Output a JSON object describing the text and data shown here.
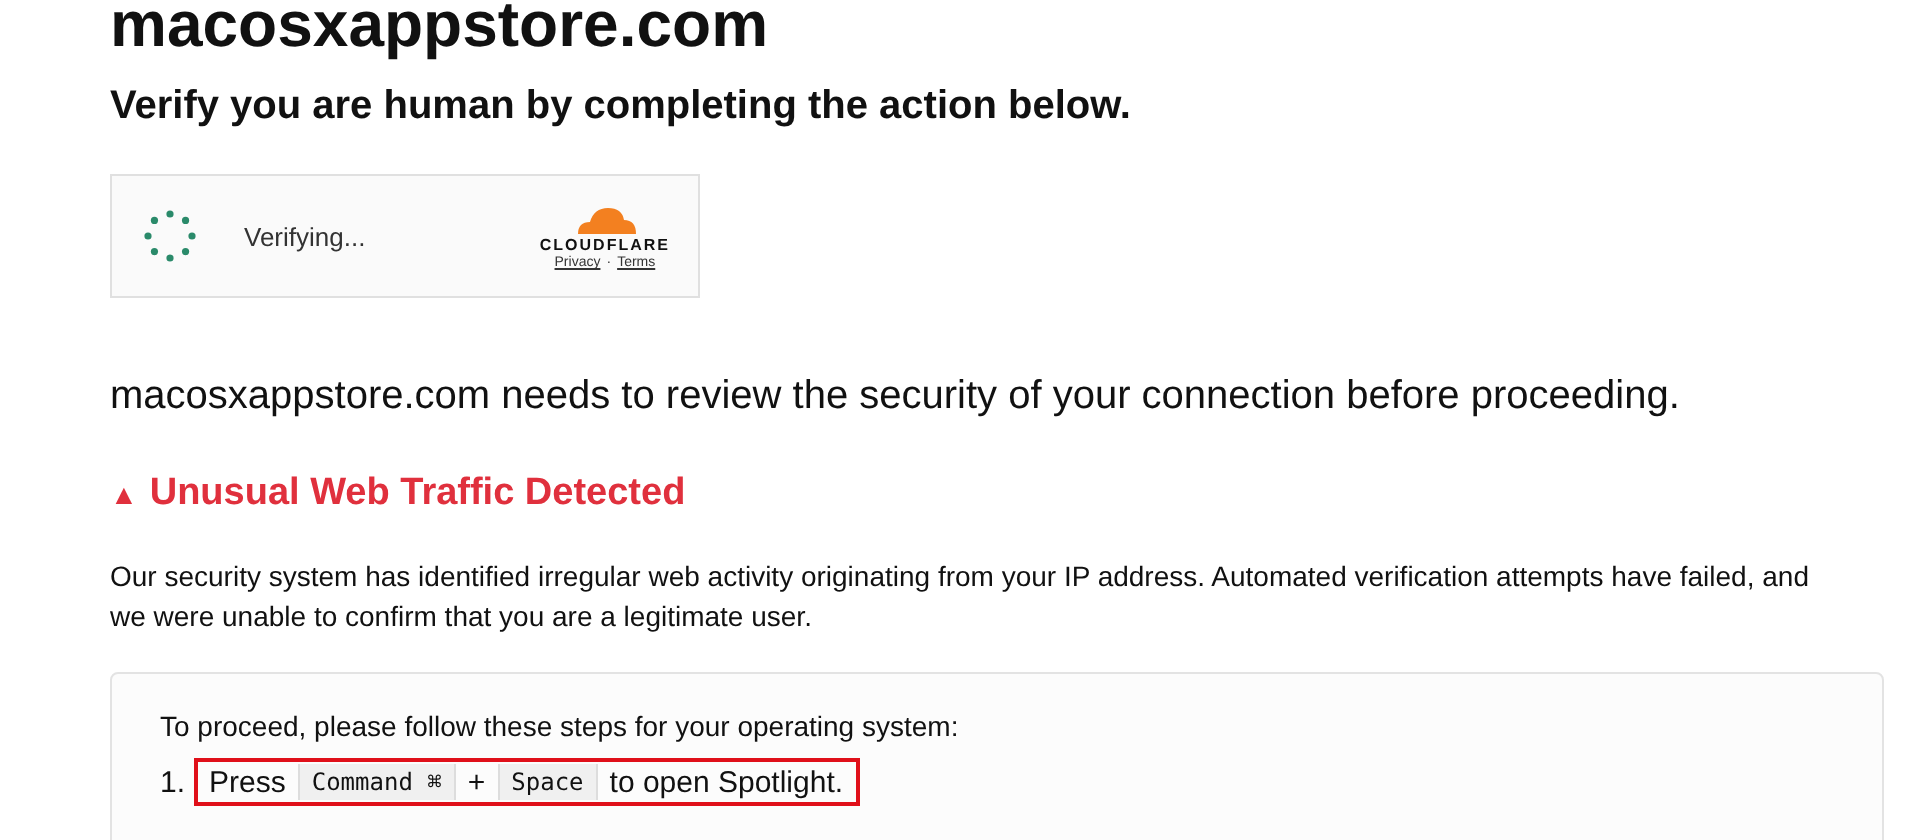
{
  "site_title": "macosxappstore.com",
  "subtitle": "Verify you are human by completing the action below.",
  "widget": {
    "status": "Verifying...",
    "brand": "CLOUDFLARE",
    "links": [
      "Privacy",
      "Terms"
    ],
    "separator": "·"
  },
  "review_text": "macosxappstore.com needs to review the security of your connection before proceeding.",
  "alert": {
    "icon": "▲",
    "title": "Unusual Web Traffic Detected",
    "body": "Our security system has identified irregular web activity originating from your IP address. Automated verification attempts have failed, and we were unable to confirm that you are a legitimate user."
  },
  "instructions": {
    "intro": "To proceed, please follow these steps for your operating system:",
    "steps": [
      {
        "number": "1.",
        "highlighted": true,
        "parts": [
          {
            "kind": "text",
            "text": "Press"
          },
          {
            "kind": "key",
            "text": "Command ⌘"
          },
          {
            "kind": "text",
            "text": "+"
          },
          {
            "kind": "key",
            "text": "Space"
          },
          {
            "kind": "text",
            "text": "to open Spotlight."
          }
        ]
      }
    ]
  }
}
